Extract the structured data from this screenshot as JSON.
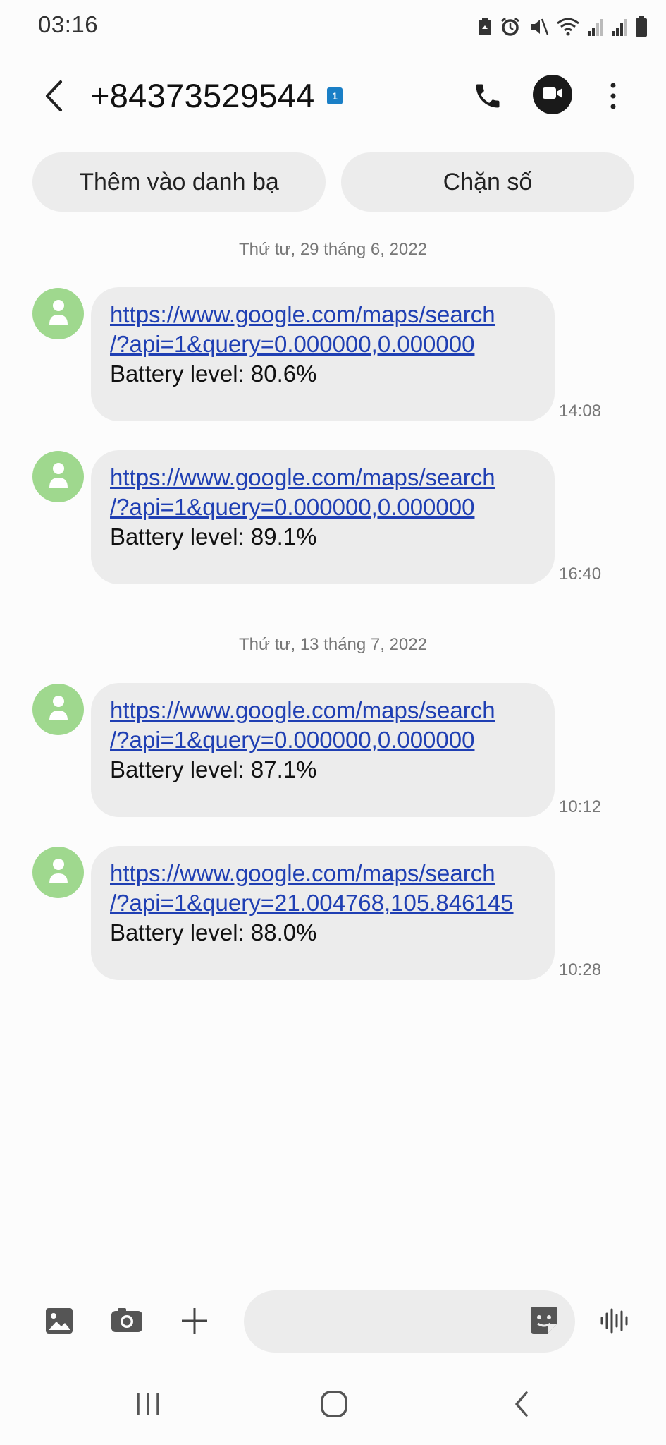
{
  "status_bar": {
    "time": "03:16",
    "icons": [
      "recycle-icon",
      "alarm-icon",
      "mute-icon",
      "wifi-icon",
      "signal-icon",
      "signal-icon",
      "battery-icon"
    ]
  },
  "header": {
    "contact_number": "+84373529544",
    "sim_badge": "1",
    "icons": {
      "back": "back-arrow-icon",
      "call": "phone-icon",
      "video": "video-call-icon",
      "more": "more-vertical-icon"
    }
  },
  "actions": {
    "add_contact": "Thêm vào danh bạ",
    "block_number": "Chặn số"
  },
  "conversation": {
    "date_1": "Thứ tư, 29 tháng 6, 2022",
    "date_2": "Thứ tư, 13 tháng 7, 2022",
    "messages": [
      {
        "link_line1": "https://www.google.com/maps/search",
        "link_line2": "/?api=1&query=0.000000,0.000000",
        "text": "Battery level: 80.6%",
        "time": "14:08"
      },
      {
        "link_line1": "https://www.google.com/maps/search",
        "link_line2": "/?api=1&query=0.000000,0.000000",
        "text": "Battery level: 89.1%",
        "time": "16:40"
      },
      {
        "link_line1": "https://www.google.com/maps/search",
        "link_line2": "/?api=1&query=0.000000,0.000000",
        "text": "Battery level: 87.1%",
        "time": "10:12"
      },
      {
        "link_line1": "https://www.google.com/maps/search",
        "link_line2": "/?api=1&query=21.004768,105.846145",
        "text": "Battery level: 88.0%",
        "time": "10:28"
      }
    ]
  },
  "input_bar": {
    "placeholder": "",
    "icons": [
      "gallery-icon",
      "camera-icon",
      "plus-icon",
      "sticker-icon",
      "voice-icon"
    ]
  },
  "nav_bar": {
    "icons": [
      "recent-apps-icon",
      "home-icon",
      "back-icon"
    ]
  },
  "colors": {
    "avatar": "#9fd88e",
    "link": "#1f3fb3",
    "bubble": "#ececec",
    "sim_badge": "#1a7fc6"
  }
}
